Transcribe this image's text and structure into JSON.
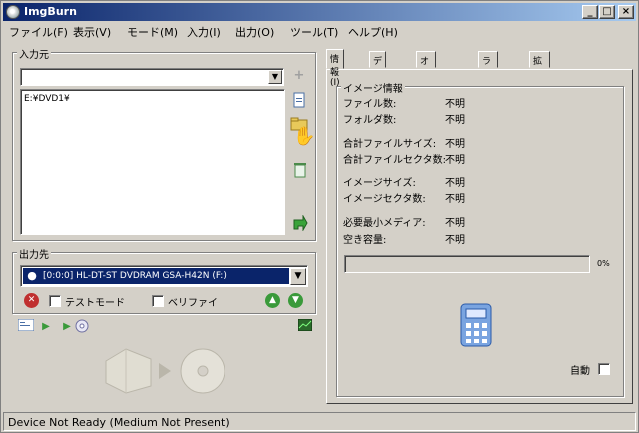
{
  "window": {
    "title": "ImgBurn"
  },
  "title_buttons": {
    "minimize": "_",
    "maximize": "□",
    "close": "×"
  },
  "menu": {
    "items": [
      "ファイル(F)",
      "表示(V)",
      "モード(M)",
      "入力(I)",
      "出力(O)",
      "ツール(T)",
      "ヘルプ(H)"
    ]
  },
  "input_group": {
    "label": "入力元",
    "combo_value": "",
    "file_list": [
      "E:¥DVD1¥"
    ]
  },
  "output_group": {
    "label": "出力先",
    "drive": "[0:0:0] HL-DT-ST DVDRAM GSA-H42N (F:)",
    "test_mode": {
      "label": "テストモード",
      "checked": false
    },
    "verify": {
      "label": "ベリファイ",
      "checked": false
    }
  },
  "tabs": [
    {
      "label": "情報(I)",
      "active": true
    },
    {
      "label": "デバイス",
      "active": false
    },
    {
      "label": "オプション(P)",
      "active": false
    },
    {
      "label": "ラベル(L)",
      "active": false
    },
    {
      "label": "拡張(A)",
      "active": false
    }
  ],
  "info": {
    "group_label": "イメージ情報",
    "rows": [
      {
        "label": "ファイル数:",
        "value": "不明"
      },
      {
        "label": "フォルダ数:",
        "value": "不明"
      },
      {
        "label": "合計ファイルサイズ:",
        "value": "不明"
      },
      {
        "label": "合計ファイルセクタ数:",
        "value": "不明"
      },
      {
        "label": "イメージサイズ:",
        "value": "不明"
      },
      {
        "label": "イメージセクタ数:",
        "value": "不明"
      },
      {
        "label": "必要最小メディア:",
        "value": "不明"
      },
      {
        "label": "空き容量:",
        "value": "不明"
      }
    ],
    "progress_text": "0%",
    "progress_value": 0,
    "auto_label": "自動",
    "auto_checked": false
  },
  "status": {
    "text": "Device Not Ready (Medium Not Present)"
  },
  "colors": {
    "title_start": "#0a246a",
    "title_end": "#a6caf0",
    "selection": "#0a246a",
    "face": "#d4d0c8"
  }
}
